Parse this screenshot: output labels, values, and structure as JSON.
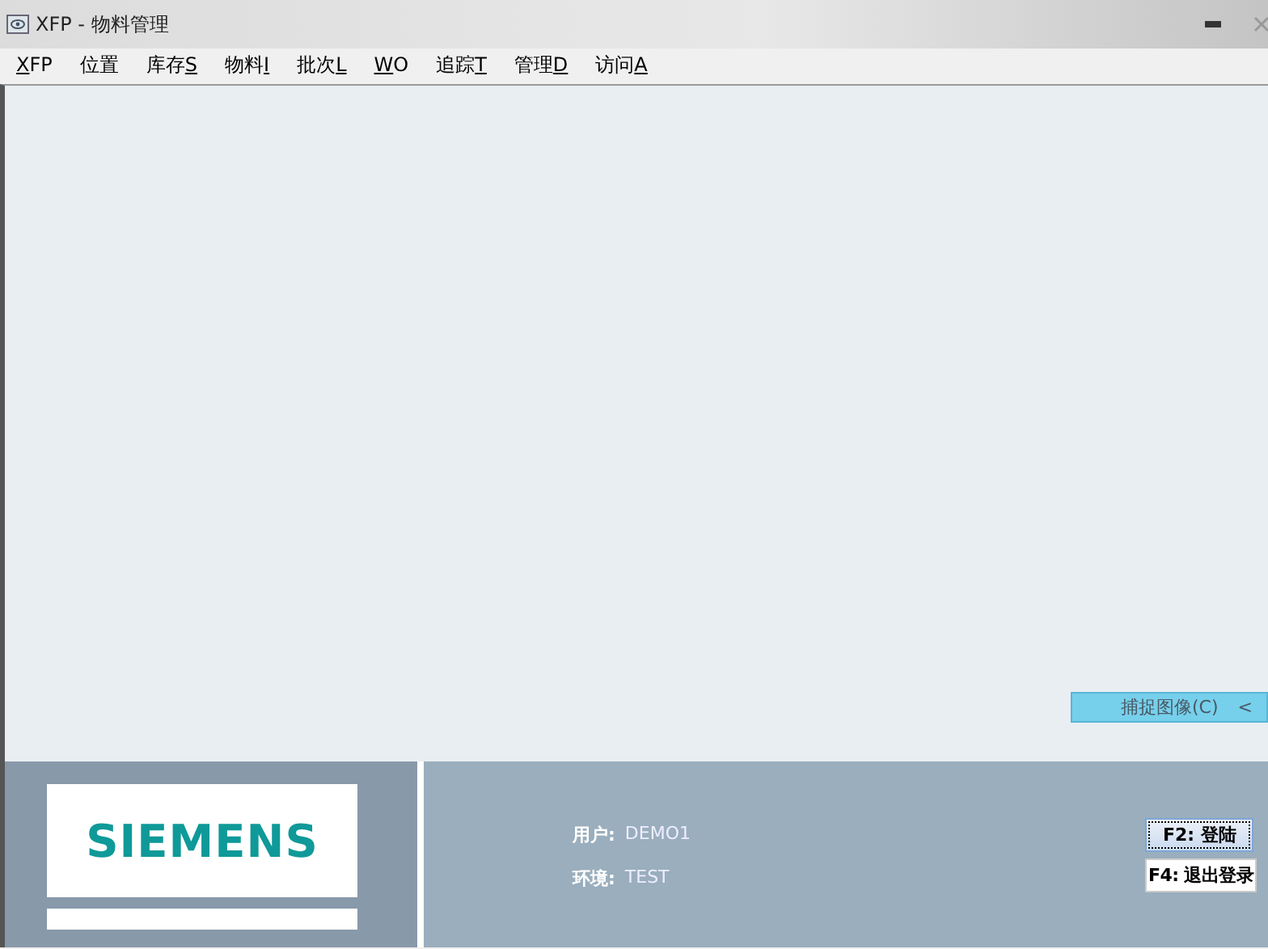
{
  "window": {
    "title": "XFP - 物料管理"
  },
  "menu": [
    {
      "label": "XFP",
      "underline_first": true,
      "underline_last": false
    },
    {
      "label": "位置",
      "underline_first": false,
      "underline_last": false
    },
    {
      "label": "库存S",
      "underline_first": false,
      "underline_last": true
    },
    {
      "label": "物料I",
      "underline_first": false,
      "underline_last": true
    },
    {
      "label": "批次L",
      "underline_first": false,
      "underline_last": true
    },
    {
      "label": "WO",
      "underline_first": true,
      "underline_last": false
    },
    {
      "label": "追踪T",
      "underline_first": false,
      "underline_last": true
    },
    {
      "label": "管理D",
      "underline_first": false,
      "underline_last": true
    },
    {
      "label": "访问A",
      "underline_first": false,
      "underline_last": true
    }
  ],
  "capture_button": {
    "label": "捕捉图像(C)",
    "extra": "<"
  },
  "logo": {
    "text": "SIEMENS"
  },
  "info": [
    {
      "label": "用户:",
      "value": "DEMO1"
    },
    {
      "label": "环境:",
      "value": "TEST"
    }
  ],
  "buttons": [
    {
      "label": "F2: 登陆",
      "focused": true
    },
    {
      "label": "F4: 退出登录",
      "focused": false
    }
  ]
}
